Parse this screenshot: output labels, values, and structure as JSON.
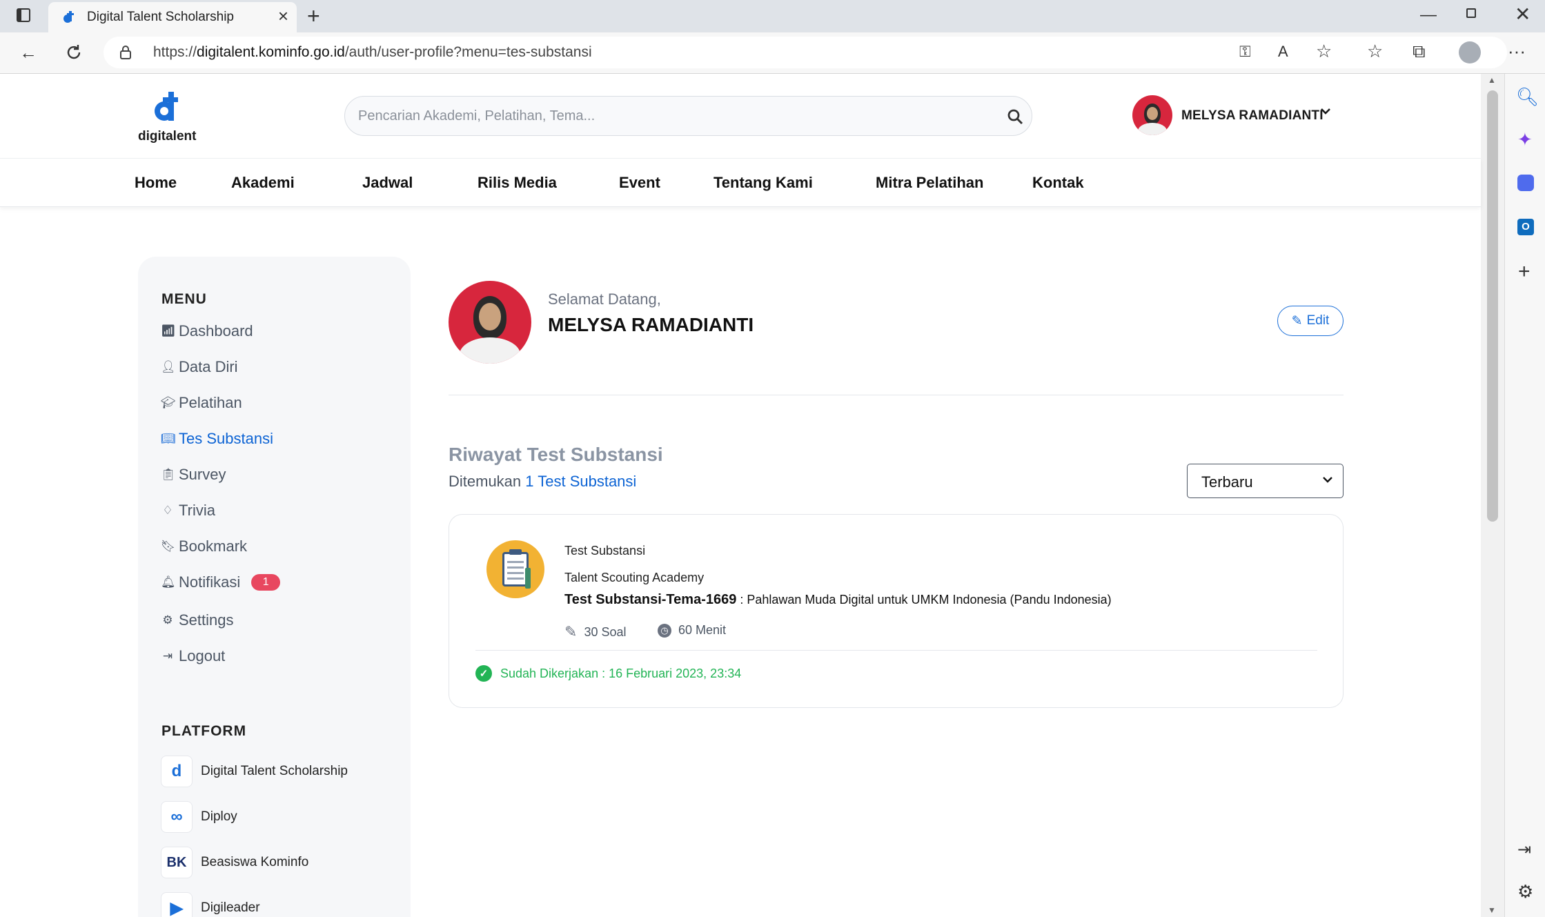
{
  "browser": {
    "tab_title": "Digital Talent Scholarship",
    "url_prefix": "https://",
    "url_domain": "digitalent.kominfo.go.id",
    "url_path": "/auth/user-profile?menu=tes-substansi"
  },
  "header": {
    "logo_text": "digitalent",
    "search_placeholder": "Pencarian Akademi, Pelatihan, Tema...",
    "user_name": "MELYSA RAMADIANTI"
  },
  "nav": [
    "Home",
    "Akademi",
    "Jadwal",
    "Rilis Media",
    "Event",
    "Tentang Kami",
    "Mitra Pelatihan",
    "Kontak"
  ],
  "sidebar": {
    "menu_title": "MENU",
    "items": [
      {
        "label": "Dashboard",
        "icon": "bar-chart-icon"
      },
      {
        "label": "Data Diri",
        "icon": "user-icon"
      },
      {
        "label": "Pelatihan",
        "icon": "graduation-cap-icon"
      },
      {
        "label": "Tes Substansi",
        "icon": "book-icon",
        "active": true
      },
      {
        "label": "Survey",
        "icon": "clipboard-icon"
      },
      {
        "label": "Trivia",
        "icon": "diamond-icon"
      },
      {
        "label": "Bookmark",
        "icon": "bookmark-icon"
      },
      {
        "label": "Notifikasi",
        "icon": "bell-icon",
        "badge": "1"
      },
      {
        "label": "Settings",
        "icon": "gear-icon"
      },
      {
        "label": "Logout",
        "icon": "logout-icon"
      }
    ],
    "platform_title": "PLATFORM",
    "platforms": [
      {
        "label": "Digital Talent Scholarship",
        "icon": "dts-logo"
      },
      {
        "label": "Diploy",
        "icon": "diploy-logo"
      },
      {
        "label": "Beasiswa Kominfo",
        "icon": "beasiswa-kominfo-logo"
      },
      {
        "label": "Digileader",
        "icon": "digileader-logo"
      }
    ]
  },
  "profile": {
    "welcome": "Selamat Datang,",
    "name": "MELYSA RAMADIANTI",
    "edit_label": "Edit"
  },
  "history": {
    "title": "Riwayat Test Substansi",
    "found_prefix": "Ditemukan",
    "found_link": "1 Test Substansi",
    "sort_value": "Terbaru",
    "card": {
      "label": "Test Substansi",
      "academy": "Talent Scouting Academy",
      "test_id": "Test Substansi-Tema-1669",
      "test_name": " : Pahlawan Muda Digital untuk UMKM Indonesia (Pandu Indonesia)",
      "soal": "30 Soal",
      "menit": "60 Menit",
      "status": "Sudah Dikerjakan : 16 Februari 2023, 23:34"
    }
  },
  "colors": {
    "primary": "#0c63d4",
    "success": "#22b455",
    "badge": "#e8475f",
    "avatar_bg": "#d7263d"
  }
}
